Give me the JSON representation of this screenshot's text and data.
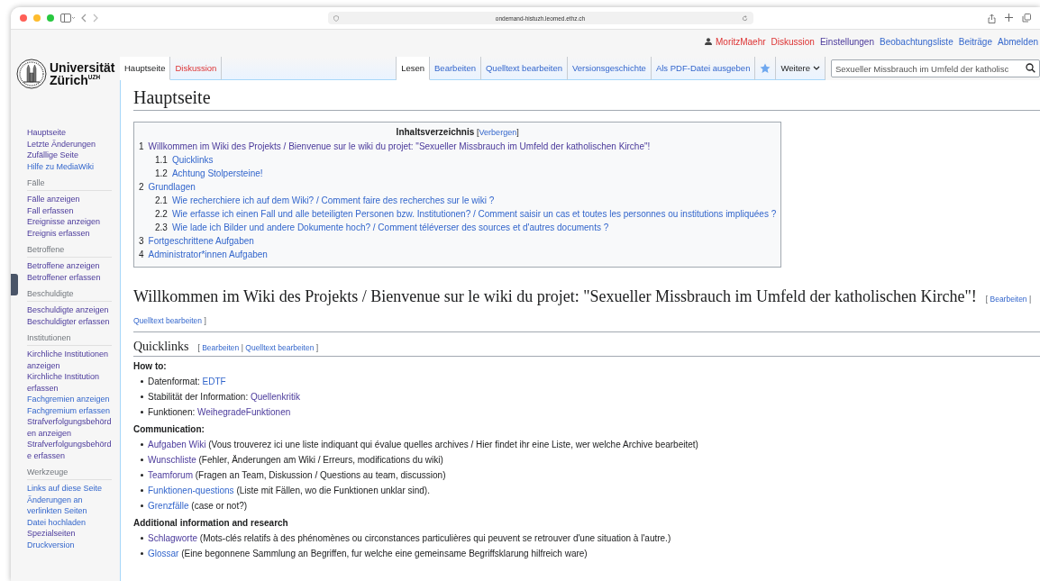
{
  "browser": {
    "url": "ondemand-histuzh.leomed.ethz.ch"
  },
  "user_links": [
    {
      "label": "MoritzMaehr",
      "kind": "user",
      "new": true
    },
    {
      "label": "Diskussion",
      "kind": "link",
      "new": true
    },
    {
      "label": "Einstellungen",
      "kind": "link",
      "new": false,
      "visited": true
    },
    {
      "label": "Beobachtungsliste",
      "kind": "link",
      "new": false,
      "visited": false
    },
    {
      "label": "Beiträge",
      "kind": "link",
      "new": false,
      "visited": false
    },
    {
      "label": "Abmelden",
      "kind": "link",
      "new": false,
      "visited": false
    }
  ],
  "logo": {
    "line1": "Universität",
    "line2": "Zürich$^{UZH}$"
  },
  "page_tabs": [
    {
      "label": "Hauptseite",
      "selected": true
    },
    {
      "label": "Diskussion",
      "selected": false,
      "new": true
    }
  ],
  "view_tabs": [
    {
      "label": "Lesen",
      "selected": true
    },
    {
      "label": "Bearbeiten",
      "selected": false
    },
    {
      "label": "Quelltext bearbeiten",
      "selected": false
    },
    {
      "label": "Versionsgeschichte",
      "selected": false
    },
    {
      "label": "Als PDF-Datei ausgeben",
      "selected": false
    }
  ],
  "more_menu": {
    "label": "Weitere"
  },
  "search": {
    "placeholder": "Sexueller Missbrauch im Umfeld der katholisc"
  },
  "sidebar": {
    "groups": [
      {
        "items": [
          {
            "label": "Hauptseite",
            "visited": true
          },
          {
            "label": "Letzte Änderungen",
            "visited": true
          },
          {
            "label": "Zufällige Seite",
            "visited": true
          },
          {
            "label": "Hilfe zu MediaWiki",
            "visited": false
          }
        ]
      },
      {
        "heading": "Fälle",
        "items": [
          {
            "label": "Fälle anzeigen",
            "visited": true
          },
          {
            "label": "Fall erfassen",
            "visited": true
          },
          {
            "label": "Ereignisse anzeigen",
            "visited": true
          },
          {
            "label": "Ereignis erfassen",
            "visited": true
          }
        ]
      },
      {
        "heading": "Betroffene",
        "items": [
          {
            "label": "Betroffene anzeigen",
            "visited": true
          },
          {
            "label": "Betroffener erfassen",
            "visited": true
          }
        ]
      },
      {
        "heading": "Beschuldigte",
        "items": [
          {
            "label": "Beschuldigte anzeigen",
            "visited": true
          },
          {
            "label": "Beschuldigter erfassen",
            "visited": true
          }
        ]
      },
      {
        "heading": "Institutionen",
        "items": [
          {
            "label": "Kirchliche Institutionen anzeigen",
            "visited": true
          },
          {
            "label": "Kirchliche Institution erfassen",
            "visited": true
          },
          {
            "label": "Fachgremien anzeigen",
            "visited": false
          },
          {
            "label": "Fachgremium erfassen",
            "visited": false
          },
          {
            "label": "Strafverfolgungsbehörden anzeigen",
            "visited": true
          },
          {
            "label": "Strafverfolgungsbehörde erfassen",
            "visited": true
          }
        ]
      },
      {
        "heading": "Werkzeuge",
        "items": [
          {
            "label": "Links auf diese Seite",
            "visited": false
          },
          {
            "label": "Änderungen an verlinkten Seiten",
            "visited": false
          },
          {
            "label": "Datei hochladen",
            "visited": false
          },
          {
            "label": "Spezialseiten",
            "visited": true
          },
          {
            "label": "Druckversion",
            "visited": false
          }
        ]
      }
    ]
  },
  "title": "Hauptseite",
  "toc": {
    "title": "Inhaltsverzeichnis",
    "toggle": {
      "open": "[",
      "label": "Verbergen",
      "close": "]"
    },
    "entries": [
      {
        "number": "1",
        "label": "Willkommen im Wiki des Projekts / Bienvenue sur le wiki du projet: \"Sexueller Missbrauch im Umfeld der katholischen Kirche\"!",
        "visited": true,
        "children": [
          {
            "number": "1.1",
            "label": "Quicklinks",
            "visited": false
          },
          {
            "number": "1.2",
            "label": "Achtung Stolpersteine!",
            "visited": false
          }
        ]
      },
      {
        "number": "2",
        "label": "Grundlagen",
        "visited": false,
        "children": [
          {
            "number": "2.1",
            "label": "Wie recherchiere ich auf dem Wiki? / Comment faire des recherches sur le wiki ?",
            "visited": false
          },
          {
            "number": "2.2",
            "label": "Wie erfasse ich einen Fall und alle beteiligten Personen bzw. Institutionen? / Comment saisir un cas et toutes les personnes ou institutions impliquées ?",
            "visited": false
          },
          {
            "number": "2.3",
            "label": "Wie lade ich Bilder und andere Dokumente hoch? / Comment téléverser des sources et d'autres documents ?",
            "visited": false
          }
        ]
      },
      {
        "number": "3",
        "label": "Fortgeschrittene Aufgaben",
        "visited": false
      },
      {
        "number": "4",
        "label": "Administrator*innen Aufgaben",
        "visited": false
      }
    ]
  },
  "sections": [
    {
      "kind": "major",
      "heading": "Willkommen im Wiki des Projekts / Bienvenue sur le wiki du projet: \"Sexueller Missbrauch im Umfeld der katholischen Kirche\"!",
      "edit": {
        "open": "[",
        "links": [
          "Bearbeiten",
          "Quelltext bearbeiten"
        ],
        "separator": "|",
        "close": "]"
      }
    },
    {
      "kind": "minor",
      "heading": "Quicklinks",
      "edit": {
        "open": "[",
        "links": [
          "Bearbeiten",
          "Quelltext bearbeiten"
        ],
        "separator": "|",
        "close": "]"
      },
      "blocks": [
        {
          "heading": "How to:",
          "items": [
            {
              "before": "Datenformat: ",
              "link": "EDTF",
              "visited": false
            },
            {
              "before": "Stabilität der Information: ",
              "link": "Quellenkritik",
              "visited": true
            },
            {
              "before": "Funktionen: ",
              "link": "WeihegradeFunktionen",
              "visited": true
            }
          ]
        },
        {
          "heading": "Communication:",
          "items": [
            {
              "link": "Aufgaben Wiki",
              "after": " (Vous trouverez ici une liste indiquant qui évalue quelles archives / Hier findet ihr eine Liste, wer welche Archive bearbeitet)",
              "visited": true
            },
            {
              "link": "Wunschliste",
              "after": " (Fehler, Änderungen am Wiki / Erreurs, modifications du wiki)",
              "visited": true
            },
            {
              "link": "Teamforum",
              "after": " (Fragen an Team, Diskussion / Questions au team, discussion)",
              "visited": true
            },
            {
              "link": "Funktionen-questions",
              "after": " (Liste mit Fällen, wo die Funktionen unklar sind).",
              "visited": false
            },
            {
              "link": "Grenzfälle",
              "after": " (case or not?)",
              "visited": false
            }
          ]
        },
        {
          "heading": "Additional information and research",
          "items": [
            {
              "link": "Schlagworte",
              "after": " (Mots-clés relatifs à des phénomènes ou circonstances particulières qui peuvent se retrouver d'une situation à l'autre.)",
              "visited": true
            },
            {
              "link": "Glossar",
              "after": " (Eine begonnene Sammlung an Begriffen, fur welche eine gemeinsame Begriffsklarung hilfreich ware)",
              "visited": false
            }
          ]
        }
      ]
    }
  ]
}
